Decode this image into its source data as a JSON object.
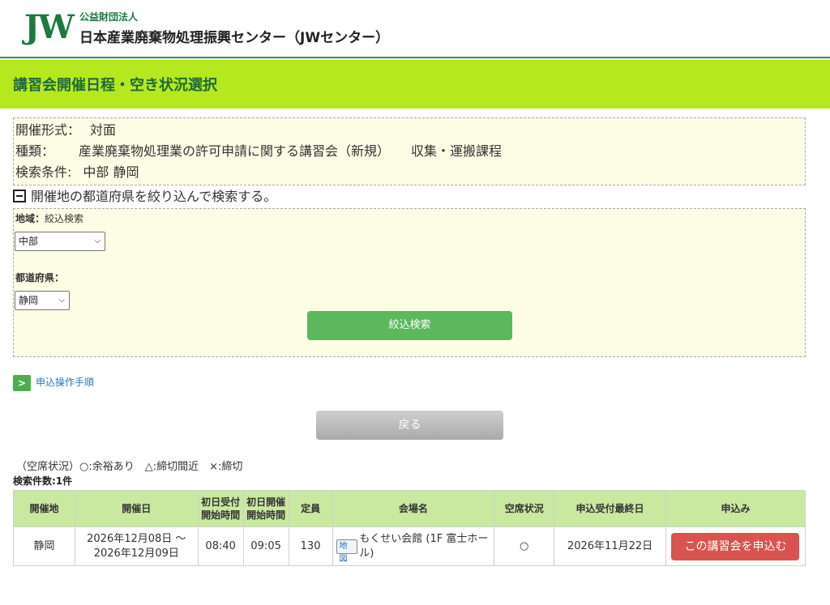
{
  "header": {
    "logo": "JW",
    "org_small": "公益財団法人",
    "org_name": "日本産業廃棄物処理振興センター（JWセンター）"
  },
  "page_title": "講習会開催日程・空き状況選択",
  "info": {
    "format_label": "開催形式：",
    "format_value": "対面",
    "type_label": "種類：",
    "type_value": "産業廃棄物処理業の許可申請に関する講習会（新規）",
    "type_course": "収集・運搬課程",
    "cond_label": "検索条件:",
    "cond_value": "中部 静岡"
  },
  "filter_toggle": "開催地の都道府県を絞り込んで検索する。",
  "filter": {
    "region_label": "地域：",
    "region_hint": "絞込検索",
    "region_value": "中部",
    "pref_label": "都道府県：",
    "pref_value": "静岡",
    "search_button": "絞込検索"
  },
  "howto_link": "申込操作手順",
  "howto_arrow": ">",
  "back_button": "戻る",
  "legend": "（空席状況）○:余裕あり　△:締切間近　×:締切",
  "result_count": "検索件数:1件",
  "table": {
    "headers": [
      "開催地",
      "開催日",
      "初日受付開始時間",
      "初日開催開始時間",
      "定員",
      "会場名",
      "空席状況",
      "申込受付最終日",
      "申込み"
    ],
    "rows": [
      {
        "place": "静岡",
        "date": "2026年12月08日 ～ 2026年12月09日",
        "reception": "08:40",
        "start": "09:05",
        "capacity": "130",
        "map": "地図",
        "venue": "もくせい会館 (1F 富士ホール)",
        "vacancy": "○",
        "deadline": "2026年11月22日",
        "apply": "この講習会を申込む"
      }
    ]
  }
}
